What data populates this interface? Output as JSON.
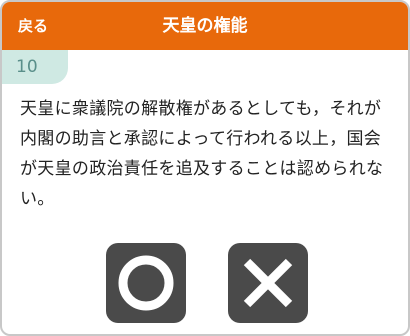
{
  "header": {
    "back_label": "戻る",
    "title": "天皇の権能",
    "color": "#e8690b"
  },
  "question": {
    "number": "10",
    "text": "天皇に衆議院の解散権があるとしても，それが内閣の助言と承認によって行われる以上，国会が天皇の政治責任を追及することは認められない。"
  },
  "answers": {
    "true_icon": "circle-maru-icon",
    "false_icon": "cross-batsu-icon",
    "button_color": "#4a4a4a"
  }
}
